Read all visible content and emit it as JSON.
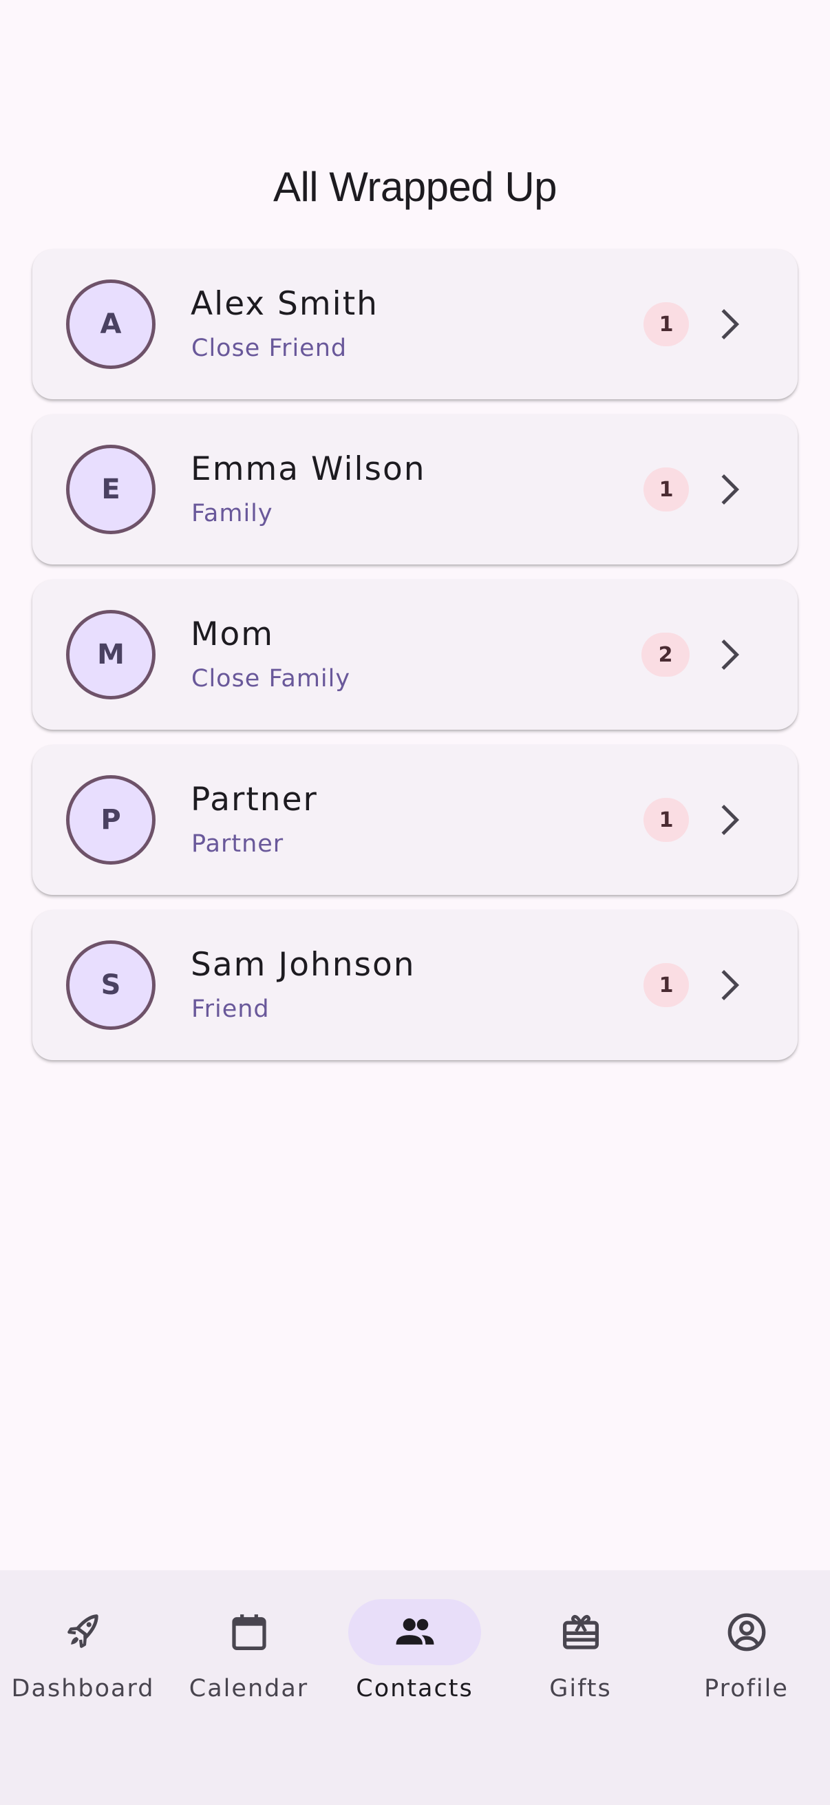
{
  "app": {
    "title": "All Wrapped Up"
  },
  "contacts": [
    {
      "initial": "A",
      "name": "Alex Smith",
      "relation": "Close Friend",
      "gift_count": "1"
    },
    {
      "initial": "E",
      "name": "Emma Wilson",
      "relation": "Family",
      "gift_count": "1"
    },
    {
      "initial": "M",
      "name": "Mom",
      "relation": "Close Family",
      "gift_count": "2"
    },
    {
      "initial": "P",
      "name": "Partner",
      "relation": "Partner",
      "gift_count": "1"
    },
    {
      "initial": "S",
      "name": "Sam Johnson",
      "relation": "Friend",
      "gift_count": "1"
    }
  ],
  "nav": {
    "active": "Contacts",
    "items": [
      {
        "label": "Dashboard",
        "icon": "rocket-icon"
      },
      {
        "label": "Calendar",
        "icon": "calendar-icon"
      },
      {
        "label": "Contacts",
        "icon": "people-icon"
      },
      {
        "label": "Gifts",
        "icon": "gift-card-icon"
      },
      {
        "label": "Profile",
        "icon": "account-circle-icon"
      }
    ]
  },
  "colors": {
    "background": "#fdf7fc",
    "card": "#f6f1f7",
    "avatar_fill": "#e8defe",
    "avatar_border": "#6e5269",
    "relation_text": "#69589a",
    "badge": "#fadde3",
    "nav_background": "#f2ecf4",
    "nav_active_pill": "#e8def9"
  }
}
